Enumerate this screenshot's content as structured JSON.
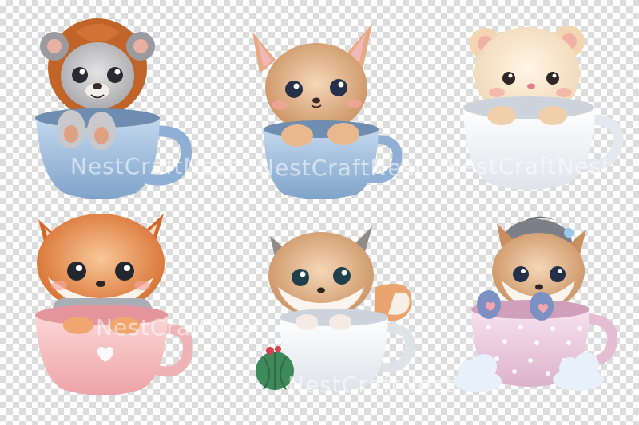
{
  "watermark": {
    "text": "NestCraftNest",
    "color": "#ffffff"
  },
  "background": {
    "pattern": "transparency-checkerboard",
    "light": "#ffffff",
    "dark": "#dcdcdc"
  },
  "illustrations": [
    {
      "animal": "lion-cub",
      "cup_color": "#a9c7e4"
    },
    {
      "animal": "fawn-kitten",
      "cup_color": "#9fbfe0"
    },
    {
      "animal": "cream-bear",
      "cup_color": "#f3f5fa"
    },
    {
      "animal": "fox-with-scarf",
      "cup_color": "#f6c3c4"
    },
    {
      "animal": "fox-with-tail",
      "cup_color": "#eef0f2",
      "extra": "cactus-ball"
    },
    {
      "animal": "hedgehog-fox",
      "cup_color": "#f4d7e4",
      "extra": "clouds"
    }
  ]
}
